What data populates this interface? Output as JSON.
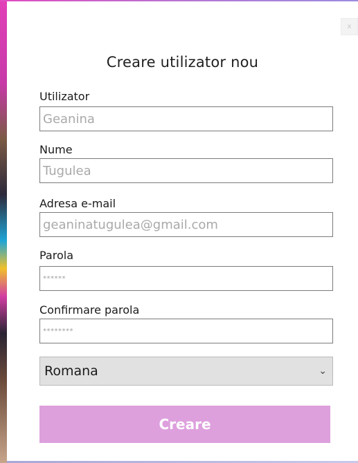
{
  "dialog": {
    "close_label": "x",
    "title": "Creare utilizator nou"
  },
  "fields": {
    "username": {
      "label": "Utilizator",
      "value": "Geanina"
    },
    "name": {
      "label": "Nume",
      "value": "Tugulea"
    },
    "email": {
      "label": "Adresa e-mail",
      "value": "geaninatugulea@gmail.com"
    },
    "password": {
      "label": "Parola",
      "value": "******"
    },
    "confirm_password": {
      "label": "Confirmare parola",
      "value": "********"
    }
  },
  "language": {
    "selected": "Romana"
  },
  "submit": {
    "label": "Creare"
  },
  "colors": {
    "accent": "#dda0dd",
    "field_border": "#7a7a7a",
    "placeholder_text": "#a9a9a9"
  }
}
